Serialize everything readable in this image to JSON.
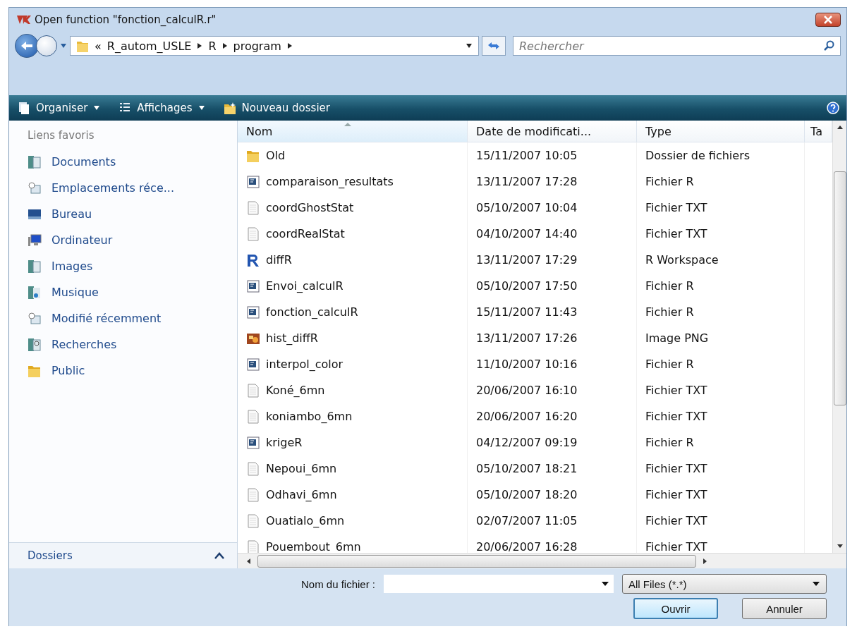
{
  "window": {
    "title": "Open function \"fonction_calculR.r\""
  },
  "nav": {
    "overflow": "«",
    "path": [
      "R_autom_USLE",
      "R",
      "program"
    ],
    "search": {
      "placeholder": "Rechercher"
    }
  },
  "toolbar": [
    {
      "label": "Organiser",
      "kind": "menu"
    },
    {
      "label": "Affichages",
      "kind": "menu"
    },
    {
      "label": "Nouveau dossier",
      "kind": "action"
    }
  ],
  "sidebar": {
    "heading": "Liens favoris",
    "items": [
      {
        "label": "Documents",
        "kind": "documents"
      },
      {
        "label": "Emplacements réce...",
        "kind": "recent"
      },
      {
        "label": "Bureau",
        "kind": "desktop"
      },
      {
        "label": "Ordinateur",
        "kind": "computer"
      },
      {
        "label": "Images",
        "kind": "documents"
      },
      {
        "label": "Musique",
        "kind": "music"
      },
      {
        "label": "Modifié récemment",
        "kind": "recent"
      },
      {
        "label": "Recherches",
        "kind": "search"
      },
      {
        "label": "Public",
        "kind": "folder"
      }
    ],
    "folders_label": "Dossiers"
  },
  "table": {
    "columns": [
      {
        "label": "Nom",
        "sorted": true
      },
      {
        "label": "Date de modificati...",
        "sorted": false
      },
      {
        "label": "Type",
        "sorted": false
      },
      {
        "label": "Ta",
        "sorted": false
      }
    ],
    "rows": [
      {
        "name": "Old",
        "kind": "folder",
        "date": "15/11/2007 10:05",
        "type": "Dossier de fichiers"
      },
      {
        "name": "comparaison_resultats",
        "kind": "rscript",
        "date": "13/11/2007 17:28",
        "type": "Fichier R"
      },
      {
        "name": "coordGhostStat",
        "kind": "text",
        "date": "05/10/2007 10:04",
        "type": "Fichier TXT"
      },
      {
        "name": "coordRealStat",
        "kind": "text",
        "date": "04/10/2007 14:40",
        "type": "Fichier TXT"
      },
      {
        "name": "diffR",
        "kind": "workspace",
        "date": "13/11/2007 17:29",
        "type": "R Workspace"
      },
      {
        "name": "Envoi_calculR",
        "kind": "rscript",
        "date": "05/10/2007 17:50",
        "type": "Fichier R"
      },
      {
        "name": "fonction_calculR",
        "kind": "rscript",
        "date": "15/11/2007 11:43",
        "type": "Fichier R"
      },
      {
        "name": "hist_diffR",
        "kind": "image",
        "date": "13/11/2007 17:26",
        "type": "Image PNG"
      },
      {
        "name": "interpol_color",
        "kind": "rscript",
        "date": "11/10/2007 10:16",
        "type": "Fichier R"
      },
      {
        "name": "Koné_6mn",
        "kind": "text",
        "date": "20/06/2007 16:10",
        "type": "Fichier TXT"
      },
      {
        "name": "koniambo_6mn",
        "kind": "text",
        "date": "20/06/2007 16:20",
        "type": "Fichier TXT"
      },
      {
        "name": "krigeR",
        "kind": "rscript",
        "date": "04/12/2007 09:19",
        "type": "Fichier R"
      },
      {
        "name": "Nepoui_6mn",
        "kind": "text",
        "date": "05/10/2007 18:21",
        "type": "Fichier TXT"
      },
      {
        "name": "Odhavi_6mn",
        "kind": "text",
        "date": "05/10/2007 18:20",
        "type": "Fichier TXT"
      },
      {
        "name": "Ouatialo_6mn",
        "kind": "text",
        "date": "02/07/2007 11:05",
        "type": "Fichier TXT"
      },
      {
        "name": "Pouembout_6mn",
        "kind": "text",
        "date": "20/06/2007 16:28",
        "type": "Fichier TXT"
      }
    ]
  },
  "footer": {
    "filename_label": "Nom du fichier :",
    "filetype": "All Files (*.*)",
    "buttons": [
      {
        "label": "Ouvrir",
        "default": true
      },
      {
        "label": "Annuler",
        "default": false
      }
    ]
  }
}
